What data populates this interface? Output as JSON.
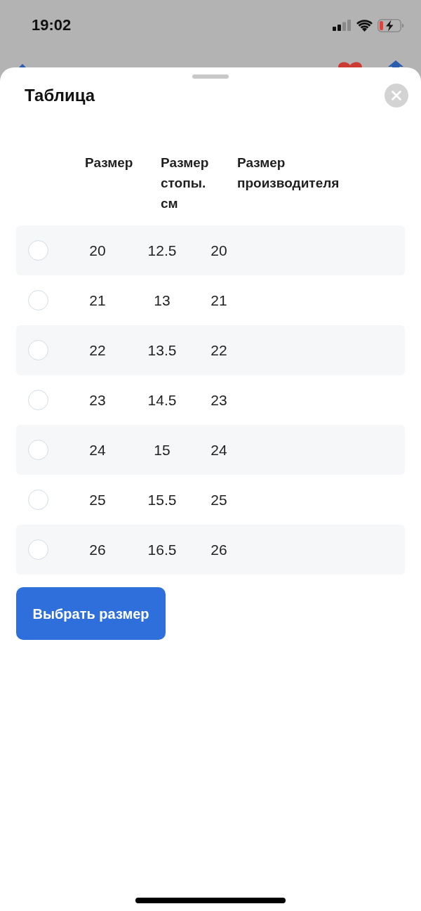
{
  "status_bar": {
    "time": "19:02"
  },
  "sheet": {
    "title": "Таблица"
  },
  "table": {
    "columns": [
      "Размер",
      "Размер стопы. см",
      "Размер производителя"
    ],
    "rows": [
      {
        "selected": false,
        "cells": [
          "20",
          "12.5",
          "20"
        ]
      },
      {
        "selected": false,
        "cells": [
          "21",
          "13",
          "21"
        ]
      },
      {
        "selected": false,
        "cells": [
          "22",
          "13.5",
          "22"
        ]
      },
      {
        "selected": false,
        "cells": [
          "23",
          "14.5",
          "23"
        ]
      },
      {
        "selected": false,
        "cells": [
          "24",
          "15",
          "24"
        ]
      },
      {
        "selected": false,
        "cells": [
          "25",
          "15.5",
          "25"
        ]
      },
      {
        "selected": false,
        "cells": [
          "26",
          "16.5",
          "26"
        ]
      }
    ]
  },
  "button": {
    "label": "Выбрать размер"
  }
}
